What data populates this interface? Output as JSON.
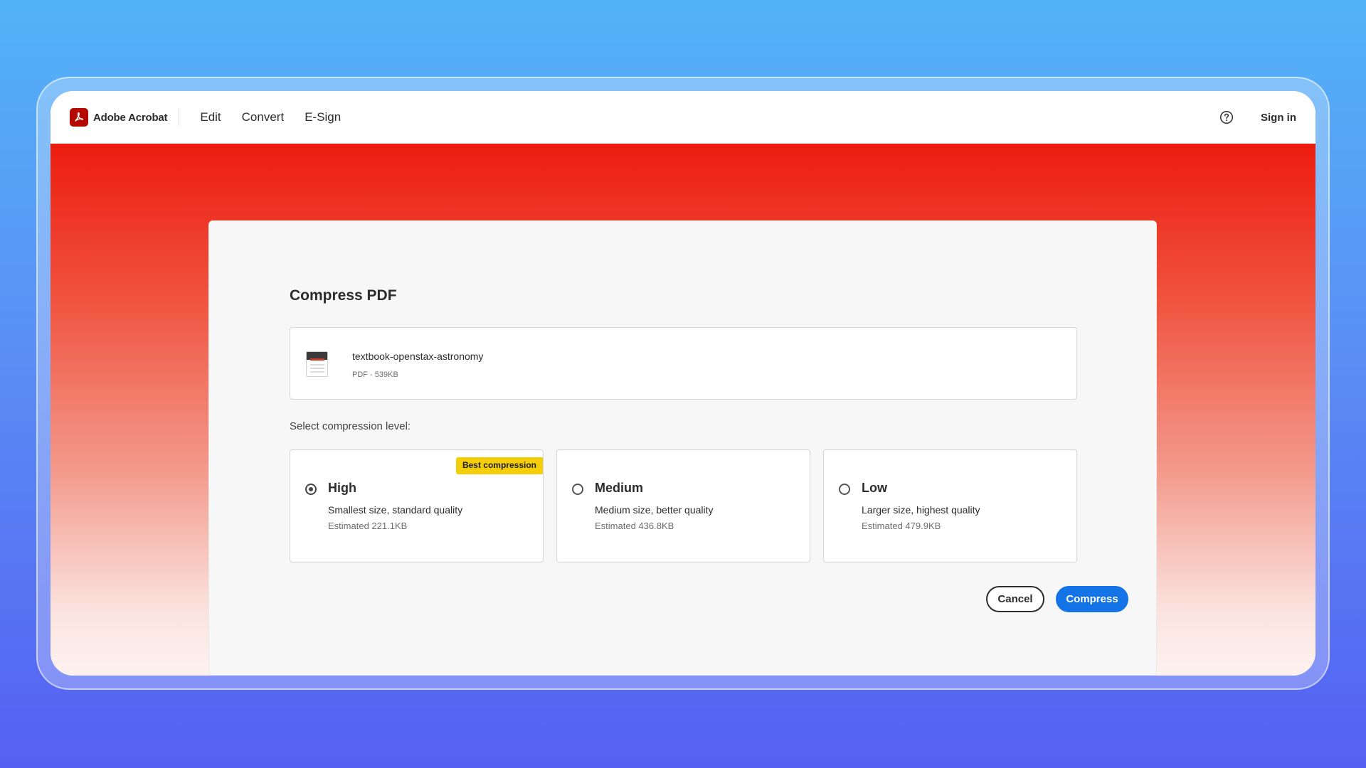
{
  "navbar": {
    "brand": "Adobe Acrobat",
    "items": [
      "Edit",
      "Convert",
      "E-Sign"
    ],
    "signin_label": "Sign in"
  },
  "dialog": {
    "title": "Compress PDF",
    "file": {
      "name": "textbook-openstax-astronomy",
      "meta": "PDF - 539KB"
    },
    "level_label": "Select compression level:",
    "options": [
      {
        "title": "High",
        "description": "Smallest size, standard quality",
        "estimate": "Estimated 221.1KB",
        "badge": "Best compression",
        "selected": true
      },
      {
        "title": "Medium",
        "description": "Medium size, better quality",
        "estimate": "Estimated 436.8KB",
        "selected": false
      },
      {
        "title": "Low",
        "description": "Larger size, highest quality",
        "estimate": "Estimated 479.9KB",
        "selected": false
      }
    ],
    "cancel_label": "Cancel",
    "compress_label": "Compress"
  },
  "colors": {
    "brand_red": "#b30b00",
    "hero_red": "#ec1c0f",
    "primary_blue": "#1473e6",
    "badge_yellow": "#f5ce0a"
  },
  "icons": {
    "logo": "acrobat-logo-icon",
    "help": "help-circle-icon",
    "file": "pdf-file-thumbnail-icon"
  }
}
